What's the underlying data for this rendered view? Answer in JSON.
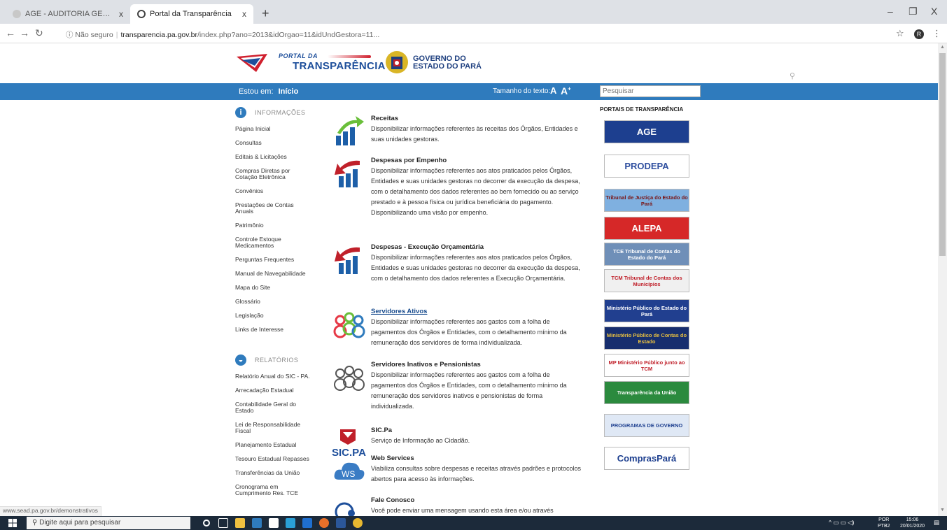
{
  "browser": {
    "tabs": [
      {
        "title": "AGE - AUDITORIA GERAL DO ES",
        "close": "x"
      },
      {
        "title": "Portal da Transparência",
        "close": "x"
      }
    ],
    "new_tab": "+",
    "window_controls": {
      "minimize": "–",
      "maximize": "❐",
      "close": "X"
    },
    "security_label": "Não seguro",
    "url_host": "transparencia.pa.gov.br",
    "url_path": "/index.php?ano=2013&idOrgao=11&idUndGestora=11...",
    "profile_initial": "R"
  },
  "header": {
    "portal_small": "PORTAL DA",
    "portal_big": "TRANSPARÊNCIA",
    "gov_line1": "GOVERNO DO",
    "gov_line2": "ESTADO DO PARÁ"
  },
  "bluebar": {
    "estou_em": "Estou em:",
    "inicio": "Início",
    "tamanho": "Tamanho do texto:",
    "a_small": "A",
    "a_big": "A",
    "search_placeholder": "Pesquisar"
  },
  "menu": {
    "info_title": "INFORMAÇÕES",
    "info_items": [
      "Página Inicial",
      "Consultas",
      "Editais & Licitações",
      "Compras Diretas por Cotação Eletrônica",
      "Convênios",
      "Prestações de Contas Anuais",
      "Patrimônio",
      "Controle Estoque Medicamentos",
      "Perguntas Frequentes",
      "Manual de Navegabilidade",
      "Mapa do Site",
      "Glossário",
      "Legislação",
      "Links de Interesse"
    ],
    "rel_title": "RELATÓRIOS",
    "rel_items": [
      "Relatório Anual do SIC - PA.",
      "Arrecadação Estadual",
      "Contabilidade Geral do Estado",
      "Lei de Responsabilidade Fiscal",
      "Planejamento Estadual",
      "Tesouro Estadual Repasses",
      "Transferências da União",
      "Cronograma em Cumprimento Res. TCE"
    ]
  },
  "entries": [
    {
      "title": "Receitas",
      "desc": "Disponibilizar informações referentes às receitas dos Órgãos, Entidades e suas unidades gestoras.",
      "icon": "chart-up-icon"
    },
    {
      "title": "Despesas por Empenho",
      "desc": "Disponibilizar informações referentes aos atos praticados pelos Órgãos, Entidades e suas unidades gestoras no decorrer da execução da despesa, com o detalhamento dos dados referentes ao bem fornecido ou ao serviço prestado e à pessoa física ou jurídica beneficiária do pagamento. Disponibilizando uma visão por empenho.",
      "icon": "chart-down-icon"
    },
    {
      "title": "Despesas - Execução Orçamentária",
      "desc": "Disponibilizar informações referentes aos atos praticados pelos Órgãos, Entidades e suas unidades gestoras no decorrer da execução da despesa, com o detalhamento dos dados referentes a Execução Orçamentária.",
      "icon": "chart-down-icon"
    },
    {
      "title": "Servidores Ativos",
      "desc": "Disponibilizar informações referentes aos gastos com a folha de pagamentos dos Órgãos e Entidades, com o detalhamento mínimo da remuneração dos servidores de forma individualizada.",
      "icon": "people-colored-icon"
    },
    {
      "title": "Servidores Inativos e Pensionistas",
      "desc": "Disponibilizar informações referentes aos gastos com a folha de pagamentos dos Órgãos e Entidades, com o detalhamento mínimo da remuneração dos servidores inativos e pensionistas de forma individualizada.",
      "icon": "people-gray-icon"
    },
    {
      "title": "SIC.Pa",
      "desc": "Serviço de Informação ao Cidadão.",
      "icon": "sic-pa-icon",
      "icon_text": "SIC.PA"
    },
    {
      "title": "Web Services",
      "desc": "Viabiliza consultas sobre despesas e receitas através padrões e protocolos abertos para acesso às informações.",
      "icon": "cloud-ws-icon",
      "icon_text": "WS"
    },
    {
      "title": "Fale Conosco",
      "desc": "Você pode enviar uma mensagem usando esta área e/ou através",
      "icon": "chat-icon"
    }
  ],
  "portals": {
    "title": "PORTAIS DE TRANSPARÊNCIA",
    "banners": [
      {
        "label": "AGE",
        "bg": "#1d3f8f",
        "fg": "#ffffff"
      },
      {
        "label": "PRODEPA",
        "bg": "#ffffff",
        "fg": "#2f4f9f"
      },
      {
        "label": "Tribunal de Justiça do Estado do Pará",
        "bg": "#7fb0e0",
        "fg": "#7a1414"
      },
      {
        "label": "ALEPA",
        "bg": "#d62828",
        "fg": "#ffffff"
      },
      {
        "label": "TCE Tribunal de Contas do Estado do Pará",
        "bg": "#6f8fb8",
        "fg": "#ffffff"
      },
      {
        "label": "TCM Tribunal de Contas dos Municípios",
        "bg": "#f0f0f0",
        "fg": "#c0202a"
      },
      {
        "label": "Ministério Público do Estado do Pará",
        "bg": "#213f8f",
        "fg": "#ffffff"
      },
      {
        "label": "Ministério Público de Contas do Estado",
        "bg": "#172e6e",
        "fg": "#e8c040"
      },
      {
        "label": "MP Ministério Público junto ao TCM",
        "bg": "#ffffff",
        "fg": "#c0202a"
      },
      {
        "label": "Transparência da União",
        "bg": "#2b8a3e",
        "fg": "#ffffff"
      },
      {
        "label": "PROGRAMAS DE GOVERNO",
        "bg": "#dfe8f5",
        "fg": "#1d3f8f"
      },
      {
        "label": "ComprasPará",
        "bg": "#ffffff",
        "fg": "#1d3f8f"
      }
    ]
  },
  "status_url": "www.sead.pa.gov.br/demonstrativos",
  "taskbar": {
    "search_placeholder": "Digite aqui para pesquisar",
    "lang_top": "POR",
    "lang_bottom": "PTB2",
    "time": "15:06",
    "date": "20/01/2020"
  },
  "colors": {
    "accent_blue": "#2f7bbd",
    "taskbar": "#1c2a3a"
  }
}
